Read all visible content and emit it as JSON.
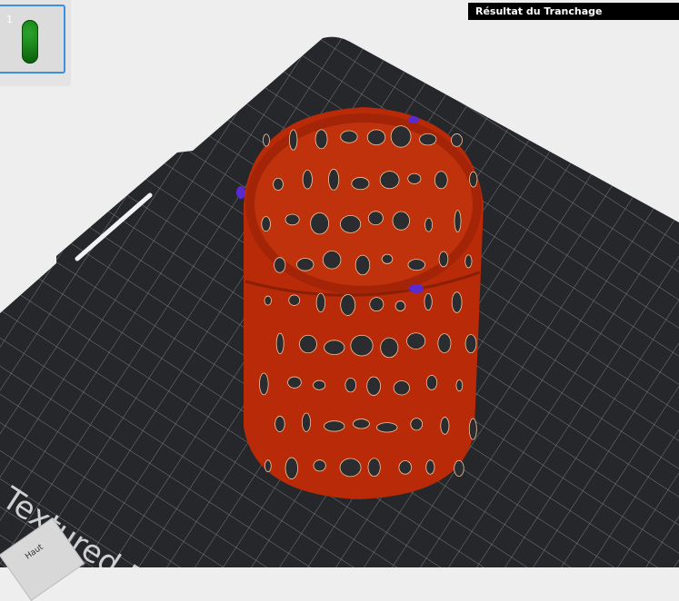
{
  "plate_list": {
    "items": [
      {
        "number": "1"
      }
    ]
  },
  "slice_result": {
    "title": "Résultat du Tranchage"
  },
  "bed": {
    "label": "Textured PEI"
  },
  "view_cube": {
    "face_label": "Haut"
  },
  "colors": {
    "bed": "#25272b",
    "grid": "#8a8d92",
    "model": "#b82a08",
    "selection": "#3d8fe0",
    "thumb_model": "#1a8a1a"
  }
}
